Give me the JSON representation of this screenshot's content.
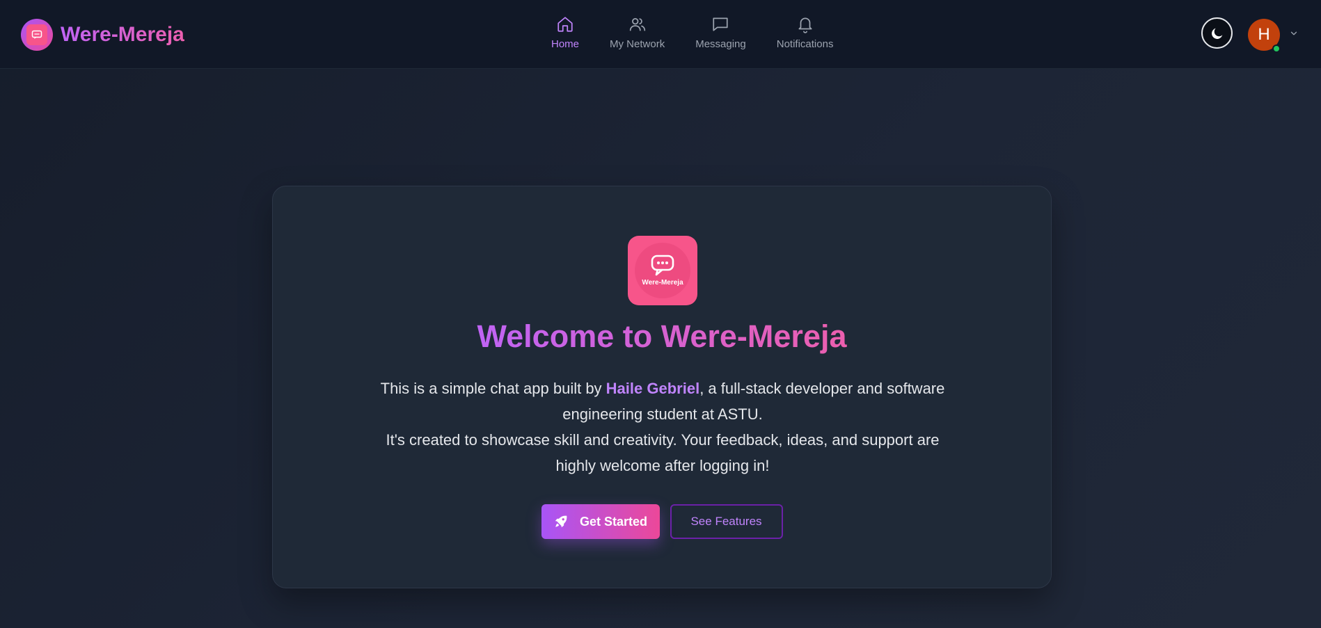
{
  "navbar": {
    "brand_name": "Were-Mereja",
    "nav_items": [
      {
        "label": "Home",
        "icon": "home-icon",
        "active": true
      },
      {
        "label": "My Network",
        "icon": "users-icon",
        "active": false
      },
      {
        "label": "Messaging",
        "icon": "message-icon",
        "active": false
      },
      {
        "label": "Notifications",
        "icon": "bell-icon",
        "active": false
      }
    ],
    "theme_toggle_icon": "moon-icon",
    "avatar_initial": "H",
    "avatar_status": "online",
    "menu_icon": "chevron-down-icon"
  },
  "hero": {
    "logo_text": "Were-Mereja",
    "title": "Welcome to Were-Mereja",
    "description_line1_prefix": "This is a simple chat app built by ",
    "author": "Haile Gebriel",
    "description_line1_suffix": ", a full-stack developer and software engineering student at ASTU.",
    "description_line2": "It's created to showcase skill and creativity. Your feedback, ideas, and support are highly welcome after logging in!",
    "primary_button": "Get Started",
    "secondary_button": "See Features"
  },
  "colors": {
    "accent_purple": "#c084fc",
    "accent_pink": "#ec4899",
    "logo_pink": "#f7558a",
    "avatar_bg": "#c2410c",
    "online_green": "#22c55e",
    "card_bg": "#1f2937",
    "navbar_bg": "#111827"
  }
}
